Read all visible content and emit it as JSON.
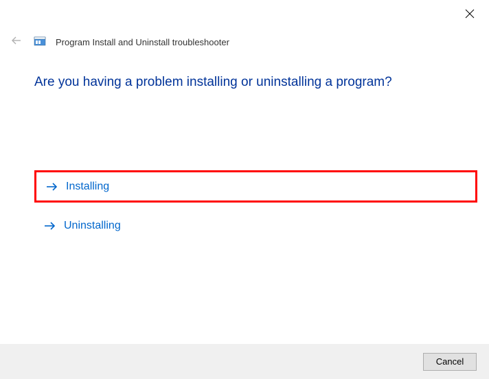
{
  "header": {
    "title": "Program Install and Uninstall troubleshooter"
  },
  "main": {
    "heading": "Are you having a problem installing or uninstalling a program?",
    "options": [
      {
        "label": "Installing",
        "highlighted": true
      },
      {
        "label": "Uninstalling",
        "highlighted": false
      }
    ]
  },
  "footer": {
    "cancel_label": "Cancel"
  }
}
